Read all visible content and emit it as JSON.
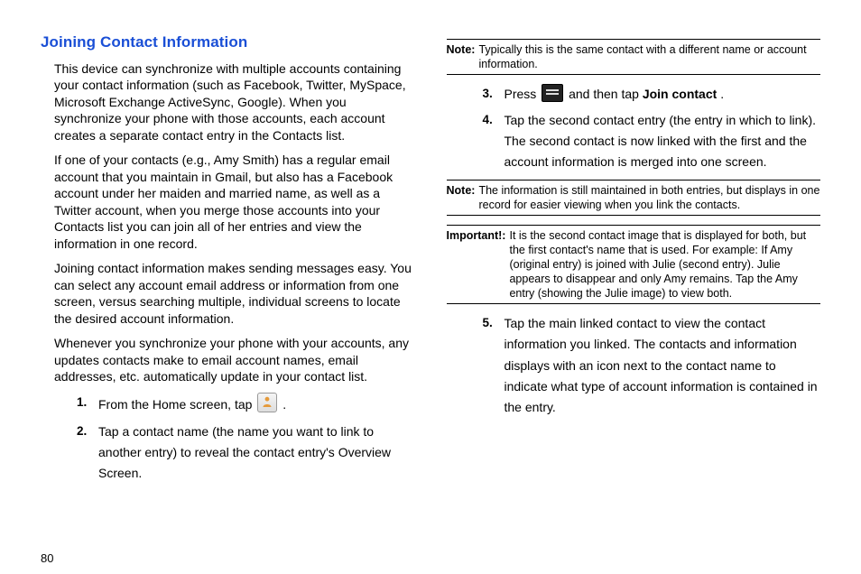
{
  "page_number": "80",
  "heading": "Joining Contact Information",
  "paragraphs": {
    "p1": "This device can synchronize with multiple accounts containing your contact information (such as Facebook, Twitter, MySpace, Microsoft Exchange ActiveSync, Google). When you synchronize your phone with those accounts, each account creates a separate contact entry in the Contacts list.",
    "p2": "If one of your contacts (e.g., Amy Smith) has a regular email account that you maintain in Gmail, but also has a Facebook account under her maiden and married name, as well as a Twitter account, when you merge those accounts into your Contacts list you can join all of her entries and view the information in one record.",
    "p3": "Joining contact information makes sending messages easy. You can select any account email address or information from one screen, versus searching multiple, individual screens to locate the desired account information.",
    "p4": "Whenever you synchronize your phone with your accounts, any updates contacts make to email account names, email addresses, etc. automatically update in your contact list."
  },
  "steps": {
    "s1_a": "From the Home screen, tap ",
    "s1_b": " .",
    "s2": "Tap a contact name (the name you want to link to another entry) to reveal the contact entry's Overview Screen.",
    "s3_a": "Press ",
    "s3_b": " and then tap ",
    "s3_c": "Join contact",
    "s3_d": ".",
    "s4": "Tap the second contact entry (the entry in which to link). The second contact is now linked with the first and the account information is merged into one screen.",
    "s5": "Tap the main linked contact to view the contact information you linked. The contacts and information displays with an icon next to the contact name to indicate what type of account information is contained in the entry."
  },
  "notes": {
    "n1_label": "Note:",
    "n1": "Typically this is the same contact with a different name or account information.",
    "n2_label": "Note:",
    "n2": "The information is still maintained in both entries, but displays in one record for easier viewing when you link the contacts.",
    "n3_label": "Important!:",
    "n3": "It is the second contact image that is displayed for both, but the first contact's name that is used. For example: If Amy (original entry) is joined with Julie (second entry). Julie appears to disappear and only Amy remains. Tap the Amy entry (showing the Julie image) to view both."
  },
  "nums": {
    "n1": "1.",
    "n2": "2.",
    "n3": "3.",
    "n4": "4.",
    "n5": "5."
  }
}
